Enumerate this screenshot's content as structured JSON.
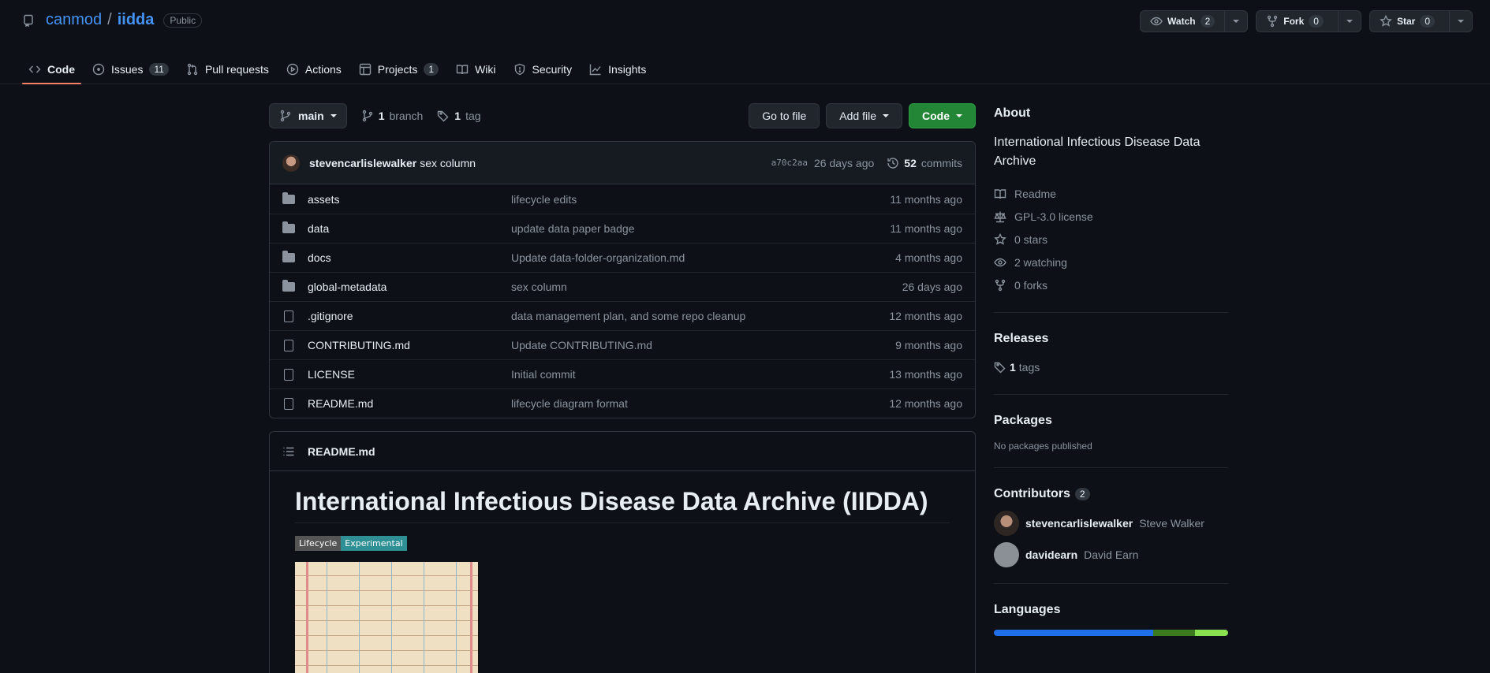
{
  "repo": {
    "owner": "canmod",
    "separator": "/",
    "name": "iidda",
    "visibility": "Public"
  },
  "actions": [
    {
      "label": "Watch",
      "count": "2",
      "icon": "eye-icon"
    },
    {
      "label": "Fork",
      "count": "0",
      "icon": "fork-icon"
    },
    {
      "label": "Star",
      "count": "0",
      "icon": "star-icon"
    }
  ],
  "tabs": [
    {
      "label": "Code",
      "icon": "code-icon",
      "active": true,
      "count": ""
    },
    {
      "label": "Issues",
      "icon": "issue-icon",
      "count": "11"
    },
    {
      "label": "Pull requests",
      "icon": "pull-request-icon",
      "count": ""
    },
    {
      "label": "Actions",
      "icon": "play-icon",
      "count": ""
    },
    {
      "label": "Projects",
      "icon": "table-icon",
      "count": "1"
    },
    {
      "label": "Wiki",
      "icon": "book-icon",
      "count": ""
    },
    {
      "label": "Security",
      "icon": "shield-icon",
      "count": ""
    },
    {
      "label": "Insights",
      "icon": "graph-icon",
      "count": ""
    }
  ],
  "branchbar": {
    "branch": "main",
    "branches_count": "1",
    "branches_label": "branch",
    "tags_count": "1",
    "tags_label": "tag",
    "go_to_file": "Go to file",
    "add_file": "Add file",
    "code": "Code"
  },
  "commit": {
    "author": "stevencarlislewalker",
    "message": "sex column",
    "sha": "a70c2aa",
    "time": "26 days ago",
    "commits_count": "52",
    "commits_label": "commits"
  },
  "files": [
    {
      "type": "folder",
      "name": "assets",
      "message": "lifecycle edits",
      "date": "11 months ago"
    },
    {
      "type": "folder",
      "name": "data",
      "message": "update data paper badge",
      "date": "11 months ago"
    },
    {
      "type": "folder",
      "name": "docs",
      "message": "Update data-folder-organization.md",
      "date": "4 months ago"
    },
    {
      "type": "folder",
      "name": "global-metadata",
      "message": "sex column",
      "date": "26 days ago"
    },
    {
      "type": "file",
      "name": ".gitignore",
      "message": "data management plan, and some repo cleanup",
      "date": "12 months ago"
    },
    {
      "type": "file",
      "name": "CONTRIBUTING.md",
      "message": "Update CONTRIBUTING.md",
      "date": "9 months ago"
    },
    {
      "type": "file",
      "name": "LICENSE",
      "message": "Initial commit",
      "date": "13 months ago"
    },
    {
      "type": "file",
      "name": "README.md",
      "message": "lifecycle diagram format",
      "date": "12 months ago"
    }
  ],
  "readme": {
    "header": "README.md",
    "title": "International Infectious Disease Data Archive (IIDDA)",
    "badge_left": "Lifecycle",
    "badge_right": "Experimental"
  },
  "sidebar": {
    "about_title": "About",
    "description": "International Infectious Disease Data Archive",
    "items": [
      {
        "icon": "book-icon",
        "label": "Readme"
      },
      {
        "icon": "law-icon",
        "label": "GPL-3.0 license"
      },
      {
        "icon": "star-icon",
        "label": "0 stars"
      },
      {
        "icon": "eye-icon",
        "label": "2 watching"
      },
      {
        "icon": "fork-icon",
        "label": "0 forks"
      }
    ],
    "releases_title": "Releases",
    "releases_count": "1",
    "releases_label": "tags",
    "packages_title": "Packages",
    "packages_text": "No packages published",
    "contributors_title": "Contributors",
    "contributors_count": "2",
    "contributors": [
      {
        "login": "stevencarlislewalker",
        "name": "Steve Walker"
      },
      {
        "login": "davidearn",
        "name": "David Earn"
      }
    ],
    "languages_title": "Languages",
    "language_colors": [
      "#1f6feb",
      "#3b7a1f",
      "#89e051"
    ]
  },
  "colors": {
    "accent": "#4493f8",
    "green": "#238636",
    "tab_underline": "#f78166"
  }
}
